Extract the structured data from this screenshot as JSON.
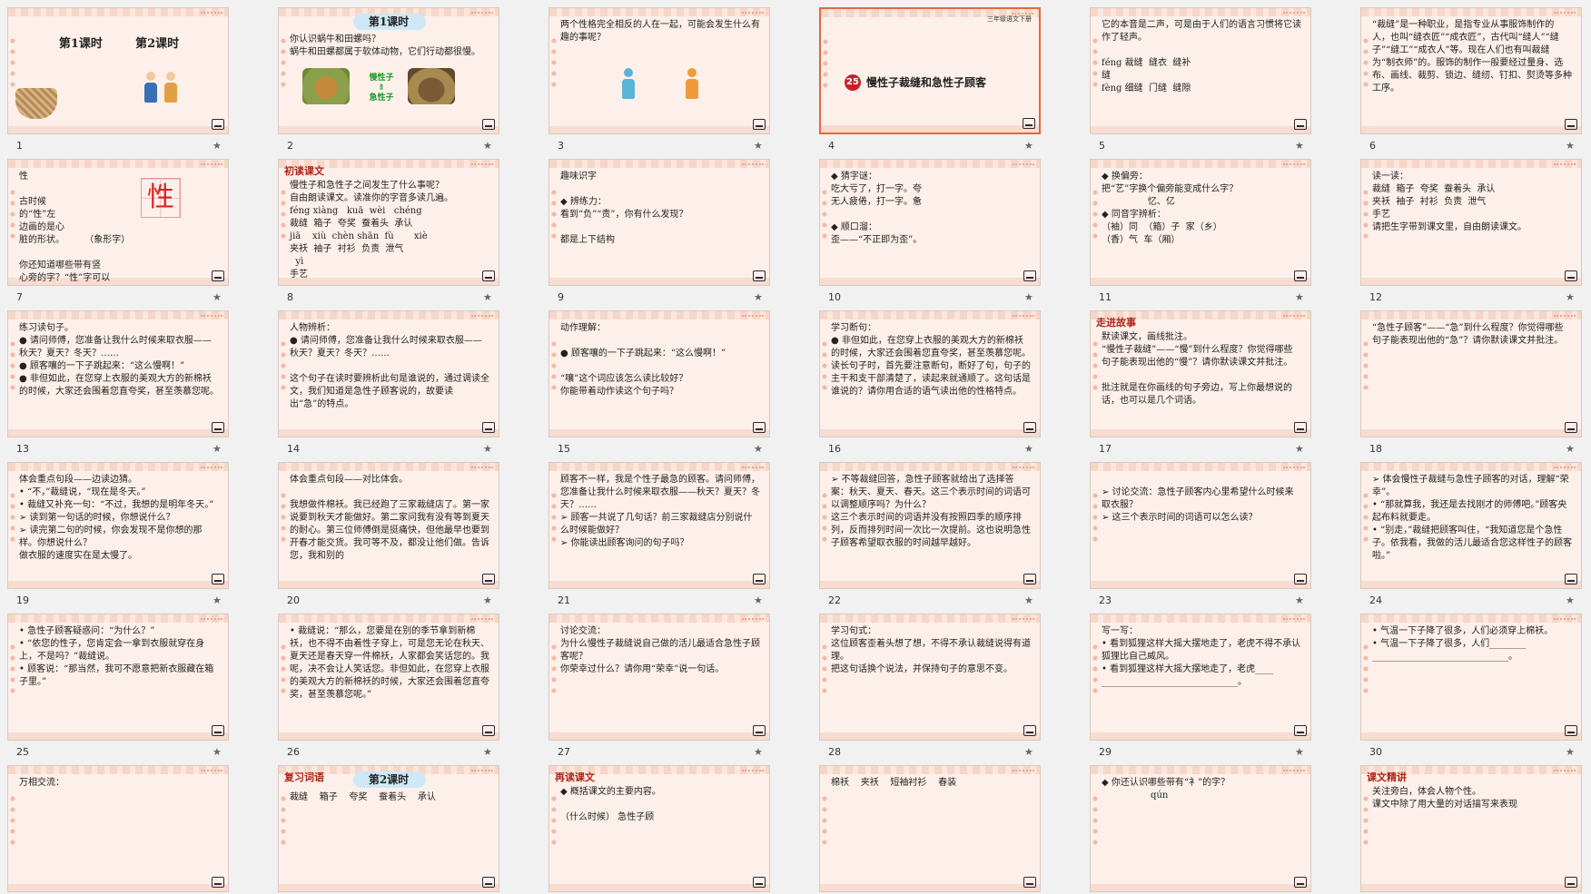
{
  "slides": [
    {
      "n": "1",
      "text": "第1课时        第2课时",
      "style": "center big",
      "sel": false
    },
    {
      "n": "2",
      "heading": "第1课时",
      "text": "你认识蜗牛和田螺吗？\n蜗牛和田螺都属于软体动物，它们行动都很慢。",
      "extra": "慢性子\n⇕\n急性子",
      "sel": false
    },
    {
      "n": "3",
      "text": "两个性格完全相反的人在一起，可能会发生什么有趣的事呢？",
      "sel": false
    },
    {
      "n": "4",
      "corner": "三年级语文下册",
      "badge": "25",
      "title": "慢性子裁缝和急性子顾客",
      "sel": true
    },
    {
      "n": "5",
      "text": "它的本音是二声，可是由于人们的语言习惯将它读作了轻声。\n\nféng 裁缝  缝衣  缝补\n缝\nfèng 细缝  门缝  缝隙",
      "sel": false
    },
    {
      "n": "6",
      "text": "“裁缝”是一种职业，是指专业从事服饰制作的人，也叫“缝衣匠”“成衣匠”，古代叫“缝人”“缝子”“缝工”“成衣人”等。现在人们也有叫裁缝为“制衣师”的。服饰的制作一般要经过量身、选布、画线、裁剪、锁边、缝纫、钉扣、熨烫等多种工序。",
      "sel": false
    },
    {
      "n": "7",
      "text": "性\n\n古时候\n的“性”左\n边画的是心\n脏的形状。       （象形字）\n\n你还知道哪些带有竖\n心旁的字？“性”字可以\n组什么词语？",
      "charbig": "性",
      "sel": false
    },
    {
      "n": "8",
      "redtitle": "初读课文",
      "text": "慢性子和急性子之间发生了什么事呢？\n自由朗读课文。读准你的字音多读几遍。\nféng xiàng   kuā  wèi   chéng\n裁缝  箱子  夸奖  蚕着头  承认\njiā    xiù  chèn shān  fù       xiè\n夹袄  袖子  衬衫  负责  泄气\n  yì\n手艺",
      "sel": false
    },
    {
      "n": "9",
      "text": "趣味识字\n\n◆ 辨练力：\n看到“负”“责”，你有什么发现？\n\n都是上下结构",
      "sel": false
    },
    {
      "n": "10",
      "text": "◆ 猜字谜：\n吃大亏了，打一字。夸\n无人疲倦，打一字。惫\n\n◆ 顺口溜：\n歪——“不正即为歪”。",
      "sel": false
    },
    {
      "n": "11",
      "text": "◆ 换偏旁：\n把“艺”字换个偏旁能变成什么字？\n                忆、亿\n◆ 同音字辨析：\n（袖）同  （箱）子  家（乡）\n（香）气  车（厢）",
      "sel": false
    },
    {
      "n": "12",
      "text": "读一读：\n裁缝  箱子  夸奖  蚕着头  承认\n夹袄  袖子  衬衫  负责  泄气\n手艺\n请把生字带到课文里，自由朗读课文。",
      "sel": false
    },
    {
      "n": "13",
      "text": "练习读句子。\n● 请问师傅，您准备让我什么时候来取衣服——秋天？夏天？冬天？……\n● 顾客嚷的一下子跳起来：“这么慢啊！”\n● 非但如此，在您穿上衣服的美观大方的新棉袄的时候，大家还会围着您直夸奖，甚至羡慕您呢。",
      "sel": false
    },
    {
      "n": "14",
      "text": "人物辨析：\n● 请问师傅，您准备让我什么时候来取衣服——秋天？夏天？冬天？……\n\n这个句子在读时要辨析此句是谁说的，通过调读全文，我们知道是急性子顾客说的，故要读出“急”的特点。",
      "sel": false
    },
    {
      "n": "15",
      "text": "动作理解：\n\n● 顾客嚷的一下子跳起来：“这么慢啊！”\n\n“嚷”这个词应该怎么读比较好？\n你能带着动作读这个句子吗？",
      "sel": false
    },
    {
      "n": "16",
      "text": "学习断句：\n● 非但如此，在您穿上衣服的美观大方的新棉袄的时候，大家还会围着您直夸奖，甚至羡慕您呢。\n读长句子时，首先要注意断句，断好了句，句子的主干和支干部清楚了，读起来就通顺了。这句话是谁说的？请你用合适的语气读出他的性格特点。",
      "sel": false
    },
    {
      "n": "17",
      "redtitle": "走进故事",
      "text": "默读课文，画线批注。\n“慢性子裁缝”——“慢”到什么程度？你觉得哪些句子能表现出他的“慢”？请你默读课文并批注。\n\n批注就是在你画线的句子旁边，写上你最想说的话，也可以是几个词语。",
      "sel": false
    },
    {
      "n": "18",
      "text": "“急性子顾客”——“急”到什么程度？你觉得哪些句子能表现出他的“急”？请你默读课文并批注。",
      "sel": false
    },
    {
      "n": "19",
      "text": "体会重点句段——边读边猜。\n• “不，”裁缝说，“现在是冬天。”\n• 裁缝又补充一句：“不过，我想的是明年冬天。”\n➢ 读到第一句话的时候，你想说什么？\n➢ 读完第二句的时候，你会发现不是你想的那样。你想说什么？\n做衣服的速度实在是太慢了。",
      "sel": false
    },
    {
      "n": "20",
      "text": "体会重点句段——对比体会。\n\n我想做件棉袄。我已经跑了三家裁缝店了。第一家说要到秋天才能做好。第二家问我有没有等到夏天的耐心。第三位师傅倒是挺痛快，但他最早也要到开春才能交货。我可等不及，都没让他们做。告诉您，我和别的",
      "sel": false
    },
    {
      "n": "21",
      "text": "顾客不一样，我是个性子最急的顾客。请问师傅，您准备让我什么时候来取衣服——秋天？夏天？冬天？……\n➢ 顾客一共说了几句话？前三家裁缝店分别说什么时候能做好？\n➢ 你能读出顾客询问的句子吗？",
      "sel": false
    },
    {
      "n": "22",
      "text": "➢ 不等裁缝回答，急性子顾客就给出了选择答案：秋天、夏天、春天。这三个表示时间的词语可以调整顺序吗？为什么？\n这三个表示时间的词语并没有按照四季的顺序排列，反而排列时间一次比一次提前。这也说明急性子顾客希望取衣服的时间越早越好。",
      "sel": false
    },
    {
      "n": "23",
      "text": "\n➢ 讨论交流：急性子顾客内心里希望什么时候来取衣服？\n➢ 这三个表示时间的词语可以怎么读？",
      "sel": false
    },
    {
      "n": "24",
      "text": "➢ 体会慢性子裁缝与急性子顾客的对话，理解“荣幸”。\n• “那就算我，我还是去找刚才的师傅吧。”顾客央起布料就要走。\n• “别走，”裁缝把顾客叫住，“我知道您是个急性子。依我看，我做的活儿最适合您这样性子的顾客啦。”",
      "sel": false
    },
    {
      "n": "25",
      "text": "• 急性子顾客疑惑问：“为什么？”\n• “依您的性子，您肯定会一拿到衣服就穿在身上，不是吗？”裁缝说。\n• 顾客说：“那当然，我可不愿意把新衣服藏在箱子里。”",
      "sel": false
    },
    {
      "n": "26",
      "text": "• 裁缝说：“那么，您要是在别的季节拿到新棉袄，也不得不由着性子穿上，可是您无论在秋天、夏天还是春天穿一件棉袄，人家都会笑话您的。我呢，决不会让人笑话您。非但如此，在您穿上衣服的美观大方的新棉袄的时候，大家还会围着您直夸奖，甚至羡慕您呢。”",
      "sel": false
    },
    {
      "n": "27",
      "text": "讨论交流：\n为什么慢性子裁缝说自己做的活儿最适合急性子顾客呢？\n你荣幸过什么？请你用“荣幸”说一句话。",
      "sel": false
    },
    {
      "n": "28",
      "text": "学习句式：\n这位顾客歪着头想了想，不得不承认裁缝说得有道理。\n把这句话换个说法，并保持句子的意思不变。",
      "sel": false
    },
    {
      "n": "29",
      "text": "写一写：\n• 看到狐狸这样大摇大摆地走了，老虎不得不承认狐狸比自己威风。\n• 看到狐狸这样大摇大摆地走了，老虎____\n______________________________。",
      "sel": false
    },
    {
      "n": "30",
      "text": "• 气温一下子降了很多，人们必须穿上棉袄。\n• 气温一下子降了很多，人们________\n______________________________。",
      "sel": false
    },
    {
      "n": "",
      "text": "万相交流：",
      "sel": false
    },
    {
      "n": "",
      "redtitle": "复习词语",
      "heading": "第2课时",
      "text": "裁缝    箱子    夸奖    蚕着头    承认",
      "sel": false
    },
    {
      "n": "",
      "redtitle": "再读课文",
      "text": "◆ 概括课文的主要内容。\n\n（什么时候） 急性子顾",
      "sel": false
    },
    {
      "n": "",
      "text": "棉袄    夹袄    短袖衬衫    春装",
      "sel": false
    },
    {
      "n": "",
      "text": "◆ 你还认识哪些带有“衤”的字？\n                 qún",
      "sel": false
    },
    {
      "n": "",
      "redtitle": "课文精讲",
      "text": "关注旁白，体会人物个性。\n课文中除了用大量的对话描写来表现",
      "sel": false
    }
  ],
  "star_icon": "★"
}
